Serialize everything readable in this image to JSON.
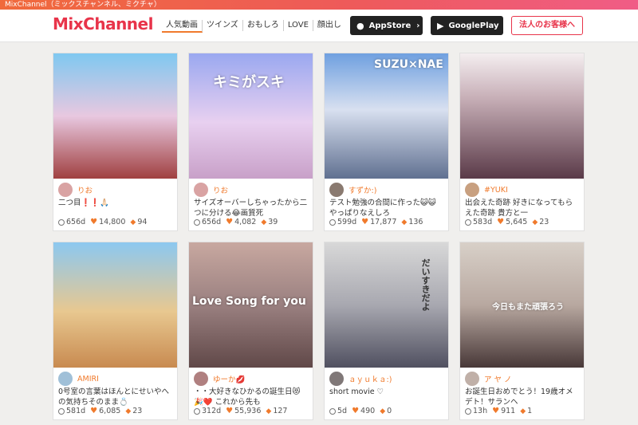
{
  "topbar": {
    "text": "MixChannel（ミックスチャンネル、ミクチャ）"
  },
  "header": {
    "logo": "MixChannel",
    "nav": [
      "人気動画",
      "ツインズ",
      "おもしろ",
      "LOVE",
      "顔出し"
    ],
    "appstore": "AppStore",
    "googleplay": "GooglePlay",
    "corporate": "法人のお客様へ"
  },
  "cards": [
    {
      "user": "りお",
      "desc": "二つ目❗️❗️🙏🏻",
      "age": "656d",
      "likes": "14,800",
      "comments": "94",
      "overlay": "",
      "bg": "linear-gradient(180deg,#7fc8f0 0%,#e8c8e0 50%,#a04040 100%)",
      "avatar": "#d9a3a3"
    },
    {
      "user": "りお",
      "desc": "サイズオーバーしちゃったから二つに分ける😂画質死",
      "age": "656d",
      "likes": "4,082",
      "comments": "39",
      "overlay": "キミがスキ",
      "bg": "linear-gradient(180deg,#9aa8f0 0%,#e8d0f0 55%,#c8a0c8 100%)",
      "avatar": "#d9a3a3"
    },
    {
      "user": "すずか:)",
      "desc": "テスト勉強の合間に作った😺😺やっぱりなえしろ",
      "age": "599d",
      "likes": "17,877",
      "comments": "136",
      "overlay": "SUZU×NAE",
      "bg": "linear-gradient(180deg,#6fa0e0 0%,#d8e0f0 45%,#607090 100%)",
      "avatar": "#8a7a70"
    },
    {
      "user": "#YÜKI",
      "desc": "出会えた奇跡 好きになってもらえた奇跡 貴方と一",
      "age": "583d",
      "likes": "5,645",
      "comments": "23",
      "overlay": "",
      "bg": "linear-gradient(180deg,#f4eef0 0%,#c8b0b8 35%,#5a3a48 100%)",
      "avatar": "#c8a080"
    },
    {
      "user": "AMIRI",
      "desc": "0号室の言葉はほんとにせいやへの気持ちそのまま💍",
      "age": "581d",
      "likes": "6,085",
      "comments": "23",
      "overlay": "",
      "bg": "linear-gradient(180deg,#8cc8f0 0%,#e8c890 55%,#c88a50 100%)",
      "avatar": "#a0c0d8"
    },
    {
      "user": "ゆーか💋",
      "desc": "・・大好きなひかるの誕生日😻🎉❤️ これから先も",
      "age": "312d",
      "likes": "55,936",
      "comments": "127",
      "overlay": "Love Song for you",
      "bg": "linear-gradient(180deg,#c8a8a0 0%,#9a8080 50%,#604848 100%)",
      "avatar": "#b08080"
    },
    {
      "user": "ａｙｕｋａ:)",
      "desc": "short movie ♡",
      "age": "5d",
      "likes": "490",
      "comments": "0",
      "overlay": "だいすきだよ",
      "bg": "linear-gradient(180deg,#d8d8d8 0%,#a8a8b0 50%,#505060 100%)",
      "avatar": "#807878"
    },
    {
      "user": "ア ヤ ノ",
      "desc": "お誕生日おめでとう！19歳オメデト！サランヘ",
      "age": "13h",
      "likes": "911",
      "comments": "1",
      "overlay": "今日もまた頑張ろう",
      "bg": "linear-gradient(180deg,#d8d0c8 0%,#b8a8a0 50%,#483838 100%)",
      "avatar": "#c0b0a8"
    }
  ]
}
